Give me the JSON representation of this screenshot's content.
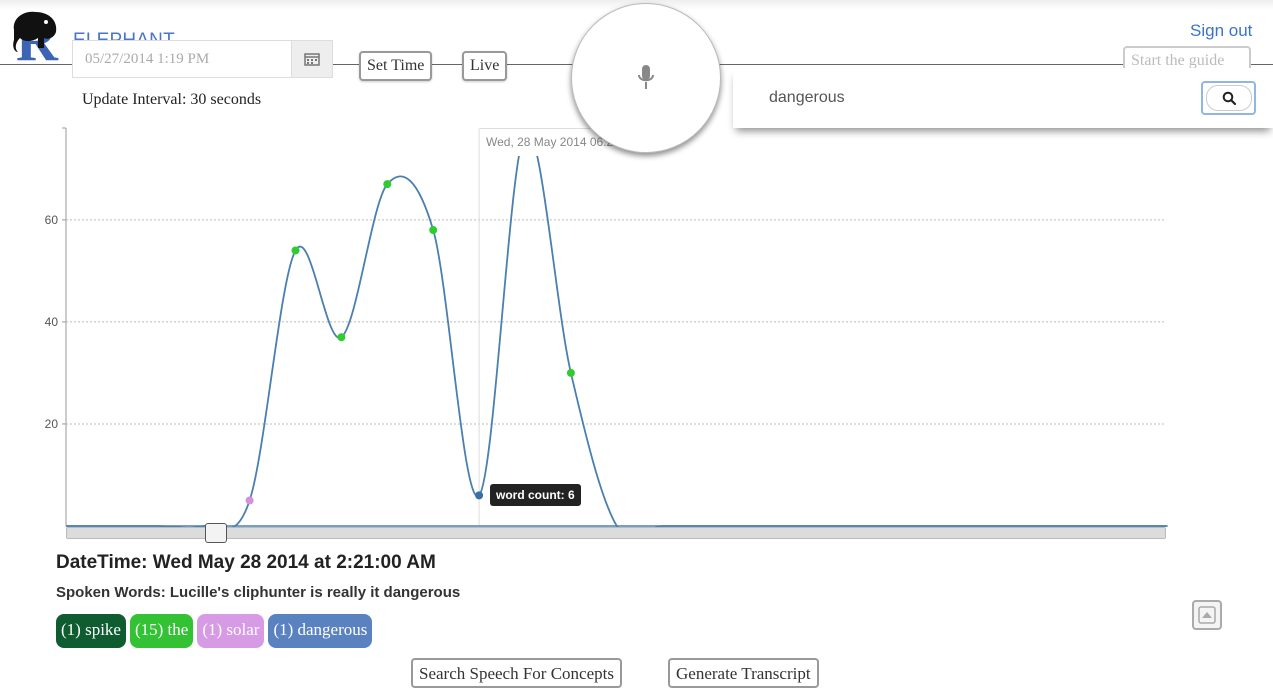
{
  "header": {
    "logo_letter": "R",
    "logo_text": "ELEPHANT",
    "sign_out": "Sign out",
    "start_guide": "Start the guide"
  },
  "controls": {
    "date_value": "05/27/2014 1:19 PM",
    "set_time": "Set Time",
    "live": "Live",
    "update_interval": "Update Interval: 30 seconds"
  },
  "search": {
    "query": "dangerous"
  },
  "chart_data": {
    "type": "line",
    "y_ticks": [
      20,
      40,
      60
    ],
    "ylim": [
      0,
      78
    ],
    "points": [
      {
        "x": 0,
        "y": 0
      },
      {
        "x": 1,
        "y": 0
      },
      {
        "x": 2,
        "y": 0
      },
      {
        "x": 3,
        "y": 0
      },
      {
        "x": 4,
        "y": 5,
        "color": "#d38fe0"
      },
      {
        "x": 5,
        "y": 54,
        "color": "#2ecc2e"
      },
      {
        "x": 6,
        "y": 37,
        "color": "#2ecc2e"
      },
      {
        "x": 7,
        "y": 67,
        "color": "#2ecc2e"
      },
      {
        "x": 8,
        "y": 58,
        "color": "#2ecc2e"
      },
      {
        "x": 9,
        "y": 6,
        "color": "#3a6ea5"
      },
      {
        "x": 10,
        "y": 77,
        "color": "#7fe07f"
      },
      {
        "x": 11,
        "y": 30,
        "color": "#2ecc2e"
      },
      {
        "x": 12,
        "y": 0
      },
      {
        "x": 13,
        "y": 0
      },
      {
        "x": 14,
        "y": 0
      },
      {
        "x": 15,
        "y": 0
      },
      {
        "x": 16,
        "y": 0
      },
      {
        "x": 17,
        "y": 0
      },
      {
        "x": 18,
        "y": 0
      },
      {
        "x": 19,
        "y": 0
      },
      {
        "x": 20,
        "y": 0
      },
      {
        "x": 21,
        "y": 0
      },
      {
        "x": 22,
        "y": 0
      },
      {
        "x": 23,
        "y": 0
      },
      {
        "x": 24,
        "y": 0
      }
    ],
    "line_color": "#4a7fb0",
    "grid": true,
    "tooltip": "word count: 6",
    "hover_label": "Wed, 28 May 2014 06:21:00"
  },
  "detail": {
    "datetime": "DateTime: Wed May 28 2014 at 2:21:00 AM",
    "spoken": "Spoken Words: Lucille's cliphunter is really it dangerous",
    "tags": [
      {
        "label": "(1) spike",
        "color": "#0e5c2f"
      },
      {
        "label": "(15) the",
        "color": "#33c233"
      },
      {
        "label": "(1) solar",
        "color": "#d79be6"
      },
      {
        "label": "(1) dangerous",
        "color": "#5a82c0"
      }
    ]
  },
  "actions": {
    "search_concepts": "Search Speech For Concepts",
    "generate_transcript": "Generate Transcript"
  },
  "icons": [
    "calendar-icon",
    "microphone-icon",
    "search-icon",
    "scroll-top-icon",
    "elephant-logo-icon"
  ]
}
